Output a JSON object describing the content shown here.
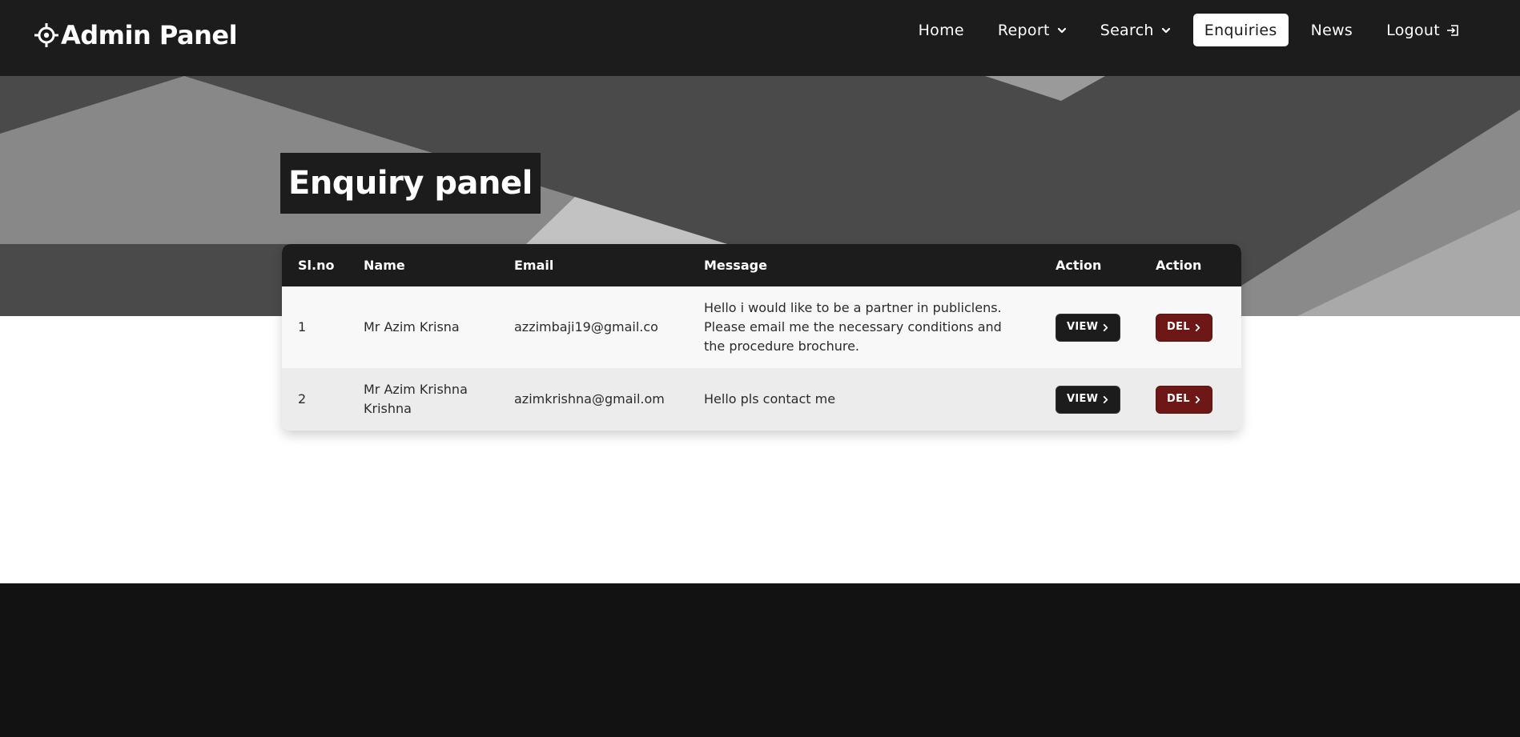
{
  "brand": {
    "title": "Admin Panel",
    "icon": "crosshair-icon"
  },
  "nav": {
    "home": "Home",
    "report": "Report",
    "search": "Search",
    "enquiries": "Enquiries",
    "news": "News",
    "logout": "Logout"
  },
  "page": {
    "title": "Enquiry panel"
  },
  "table": {
    "headers": [
      "Sl.no",
      "Name",
      "Email",
      "Message",
      "Action",
      "Action"
    ],
    "rows": [
      {
        "sl": "1",
        "name": "Mr Azim Krisna",
        "email": "azzimbaji19@gmail.co",
        "message": "Hello i would like to be a partner in publiclens. Please email me the necessary conditions and the procedure brochure.",
        "view": "VIEW",
        "del": "DEL"
      },
      {
        "sl": "2",
        "name": "Mr Azim Krishna Krishna",
        "email": "azimkrishna@gmail.om",
        "message": "Hello pls contact me",
        "view": "VIEW",
        "del": "DEL"
      }
    ]
  },
  "colors": {
    "navbar": "#1c1c1c",
    "hero": "#4a4a4a",
    "del_button": "#6e1717",
    "footer": "#121212"
  }
}
